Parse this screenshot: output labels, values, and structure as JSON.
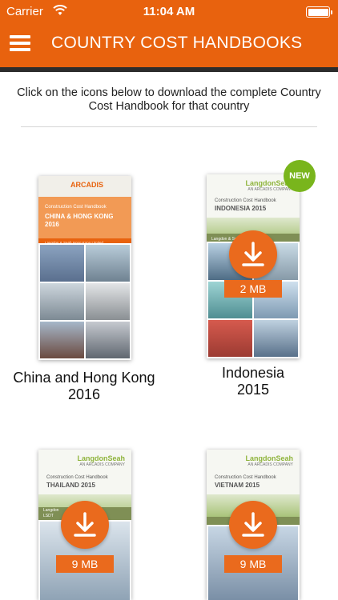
{
  "status_bar": {
    "carrier": "Carrier",
    "time": "11:04 AM"
  },
  "header": {
    "title": "COUNTRY COST HANDBOOKS"
  },
  "instructions": "Click on the icons below to download the complete Country Cost Handbook for that country",
  "colors": {
    "accent": "#e8620e",
    "new_badge": "#79b51c"
  },
  "handbooks": [
    {
      "caption_line1": "China and Hong Kong",
      "caption_line2": "2016",
      "cover_logo": "ARCADIS",
      "cover_subtitle": "Construction Cost Handbook",
      "cover_title_line1": "CHINA & HONG KONG",
      "cover_title_line2": "2016",
      "cover_strip_line1": "Langdon & Seah Hong Kong Limited",
      "cover_strip_line2": "Langdon & Seah China Limited",
      "downloaded": true
    },
    {
      "caption_line1": "Indonesia",
      "caption_line2": "2015",
      "cover_logo": "LangdonSeah",
      "cover_logo_sub": "AN ARCADIS COMPANY",
      "cover_subtitle": "Construction Cost Handbook",
      "cover_title_line1": "INDONESIA 2015",
      "cover_strip_line1": "Langdon & Seah",
      "file_size": "2 MB",
      "badge": "NEW",
      "downloaded": false
    },
    {
      "cover_logo": "LangdonSeah",
      "cover_logo_sub": "AN ARCADIS COMPANY",
      "cover_subtitle": "Construction Cost Handbook",
      "cover_title_line1": "THAILAND 2015",
      "cover_strip_line1": "Langdon",
      "cover_strip_line2": "LSDT",
      "file_size": "9 MB",
      "downloaded": false
    },
    {
      "cover_logo": "LangdonSeah",
      "cover_logo_sub": "AN ARCADIS COMPANY",
      "cover_subtitle": "Construction Cost Handbook",
      "cover_title_line1": "VIETNAM 2015",
      "file_size": "9 MB",
      "downloaded": false
    }
  ]
}
